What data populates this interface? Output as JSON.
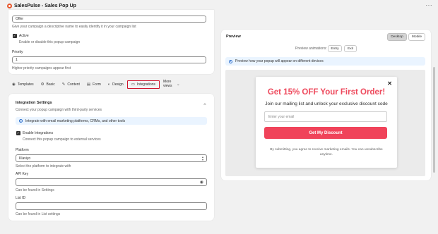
{
  "app": {
    "title": "SalesPulse - Sales Pop Up",
    "more_icon": "more-horizontal-icon",
    "accent": "#e8562a"
  },
  "general": {
    "name_value": "Offer",
    "name_help": "Give your campaign a descriptive name to easily identify it in your campaign list",
    "active_label": "Active",
    "active_checked": true,
    "active_help": "Enable or disable this popup campaign",
    "priority_label": "Priority",
    "priority_value": "1",
    "priority_help": "Higher priority campaigns appear first"
  },
  "tabs": [
    {
      "label": "Templates",
      "icon": "eye-icon",
      "glyph": "◉"
    },
    {
      "label": "Basic",
      "icon": "gear-icon",
      "glyph": "⚙"
    },
    {
      "label": "Content",
      "icon": "pencil-icon",
      "glyph": "✎"
    },
    {
      "label": "Form",
      "icon": "document-icon",
      "glyph": "▤"
    },
    {
      "label": "Design",
      "icon": "palette-icon",
      "glyph": "◐"
    },
    {
      "label": "Integrations",
      "icon": "database-icon",
      "glyph": "▭",
      "active": true
    },
    {
      "label": "More views",
      "icon": "chevron-down-icon",
      "glyph": "⌄"
    }
  ],
  "integrations": {
    "title": "Integration Settings",
    "subtitle": "Connect your popup campaign with third-party services",
    "collapse_glyph": "⌃",
    "info": "Integrate with email marketing platforms, CRMs, and other tools",
    "enable_label": "Enable Integrations",
    "enable_checked": true,
    "enable_help": "Connect this popup campaign to external services",
    "platform_label": "Platform",
    "platform_value": "Klaviyo",
    "platform_help": "Select the platform to integrate with",
    "api_key_label": "API Key",
    "api_key_value": "",
    "api_key_help": "Can be found in Settings",
    "list_id_label": "List ID",
    "list_id_value": "",
    "list_id_help": "Can be found in List settings"
  },
  "preview": {
    "title": "Preview",
    "device_buttons": [
      "Desktop",
      "Mobile"
    ],
    "selected_device": "Desktop",
    "animations_label": "Preview animations:",
    "animation_buttons": [
      "Entry",
      "Exit"
    ],
    "info": "Preview how your popup will appear on different devices",
    "stage_color": "#ebebeb"
  },
  "popup": {
    "headline": "Get 15% OFF Your First Order!",
    "headline_color": "#ee4a5d",
    "subheadline": "Join our mailing list and unlock your exclusive discount code",
    "email_placeholder": "Enter your email",
    "cta_label": "Get My Discount",
    "cta_color": "#f0435a",
    "disclaimer": "By submitting, you agree to receive marketing emails. You can unsubscribe anytime.",
    "close_glyph": "✕"
  }
}
